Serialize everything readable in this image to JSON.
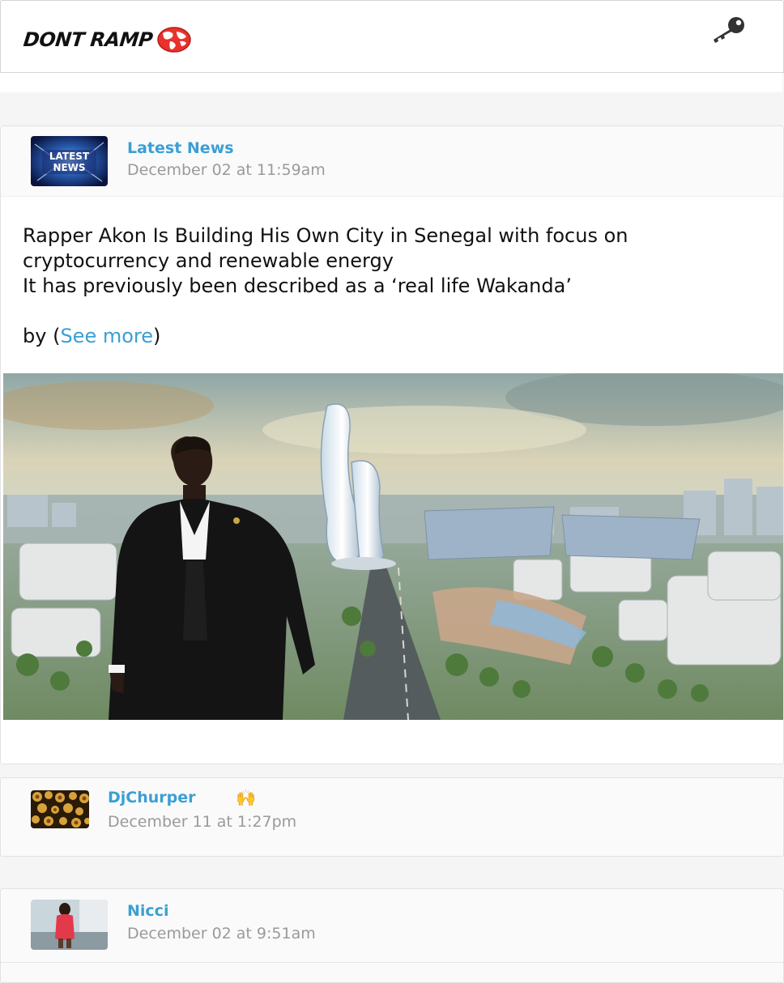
{
  "header": {
    "logo_text": "DONT RAMP",
    "login_icon": "key-icon"
  },
  "post": {
    "author": "Latest News",
    "avatar_icon": "latest-news-avatar",
    "avatar_text": "LATEST NEWS",
    "timestamp": "December 02 at 11:59am",
    "lines": [
      "Rapper Akon Is Building His Own City in Senegal with focus on cryptocurrency and renewable energy",
      "It has previously been described as a ‘real life Wakanda’"
    ],
    "by_prefix": "by (",
    "see_more": "See more",
    "by_suffix": ")"
  },
  "comment": {
    "author": "DjChurper",
    "reaction": "🙌",
    "timestamp": "December 11 at 1:27pm"
  },
  "next_post": {
    "author": "Nicci",
    "timestamp": "December 02 at 9:51am"
  },
  "colors": {
    "accent": "#3a9fd4",
    "muted": "#9a9a9a",
    "globe": "#e8322b"
  }
}
